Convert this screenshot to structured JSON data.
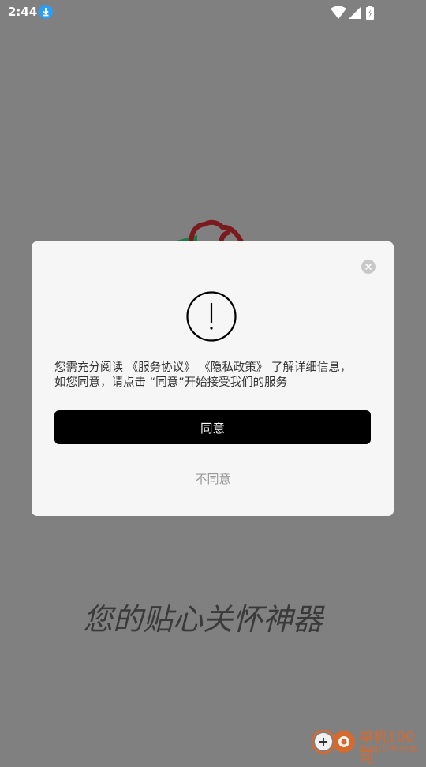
{
  "status_bar": {
    "time": "2:44"
  },
  "dialog": {
    "message_prefix": "您需充分阅读",
    "service_agreement_link": "《服务协议》",
    "privacy_policy_link": "《隐私政策》",
    "message_suffix_line1": "了解详细信息，",
    "message_line2": "如您同意，请点击 “同意”开始接受我们的服务",
    "agree_label": "同意",
    "disagree_label": "不同意"
  },
  "background": {
    "slogan": "您的贴心关怀神器"
  },
  "watermark": {
    "name": "单机100网",
    "url": "danji100.com"
  },
  "colors": {
    "overlay": "#808080",
    "dialog_bg": "#f6f6f6",
    "primary_button": "#000000",
    "download_badge": "#2a9df4",
    "watermark": "#d66a2e"
  },
  "icons": [
    "download-icon",
    "wifi-icon",
    "signal-icon",
    "battery-icon",
    "close-icon",
    "exclamation-icon"
  ]
}
